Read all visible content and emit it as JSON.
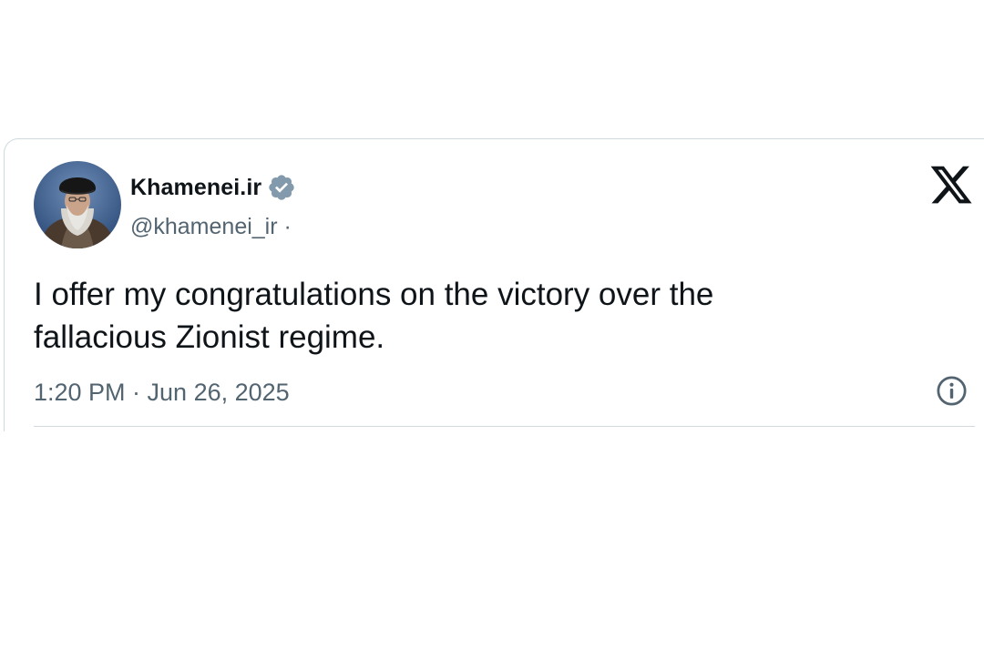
{
  "tweet": {
    "author": {
      "display_name": "Khamenei.ir",
      "handle": "@khamenei_ir",
      "handle_separator": " ·",
      "verified": true,
      "verified_color": "#829aab",
      "avatar_icon": "avatar-portrait-icon"
    },
    "text_lines": [
      "I offer my congratulations on the victory over the",
      "fallacious Zionist regime."
    ],
    "timestamp": "1:20 PM · Jun 26, 2025",
    "brand_icon": "x-logo-icon",
    "info_icon": "info-icon"
  },
  "colors": {
    "text_primary": "#0f1419",
    "text_secondary": "#536471",
    "border": "#cfd9de"
  }
}
